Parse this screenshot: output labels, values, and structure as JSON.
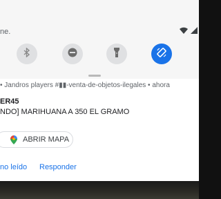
{
  "quick_settings": {
    "carrier_text": "ne.",
    "tiles": [
      {
        "icon": "bluetooth-icon",
        "active": false
      },
      {
        "icon": "do-not-disturb-icon",
        "active": false
      },
      {
        "icon": "flashlight-icon",
        "active": false
      },
      {
        "icon": "auto-rotate-icon",
        "active": true
      }
    ],
    "colors": {
      "tile_inactive": "#dfe0e2",
      "tile_active": "#1a73e8",
      "icon_inactive": "#6b6b6b",
      "icon_active": "#ffffff"
    }
  },
  "notification": {
    "meta_text": "• Jandros players #▮▮-venta-de-objetos-ilegales • ahora",
    "title": "ER45",
    "body": "NDO] MARIHUANA A 350 EL GRAMO",
    "map_button_label": "ABRIR MAPA",
    "actions": {
      "mark_read": "no leído",
      "reply": "Responder"
    },
    "accent_color": "#1a73e8"
  }
}
